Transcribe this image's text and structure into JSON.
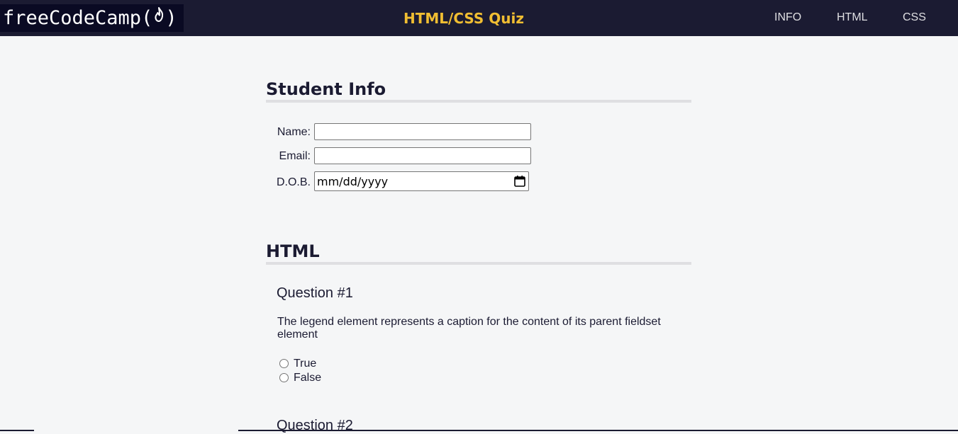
{
  "header": {
    "logo_text": "freeCodeCamp(",
    "logo_close": ")",
    "title": "HTML/CSS Quiz",
    "nav": [
      "INFO",
      "HTML",
      "CSS"
    ]
  },
  "student_info": {
    "heading": "Student Info",
    "fields": {
      "name_label": "Name:",
      "name_value": "",
      "email_label": "Email:",
      "email_value": "",
      "dob_label": "D.O.B.",
      "dob_placeholder": "mm/dd/yyyy"
    }
  },
  "html_section": {
    "heading": "HTML",
    "questions": [
      {
        "title": "Question #1",
        "text": "The legend element represents a caption for the content of its parent fieldset element",
        "options": [
          "True",
          "False"
        ]
      },
      {
        "title": "Question #2"
      }
    ]
  },
  "colors": {
    "header_bg": "#1b1b32",
    "title_accent": "#f1be32",
    "page_bg": "#f5f6f7",
    "divider": "#dfdfe2"
  },
  "icons": {
    "logo_flame": "flame-icon",
    "date_picker": "calendar-icon"
  }
}
